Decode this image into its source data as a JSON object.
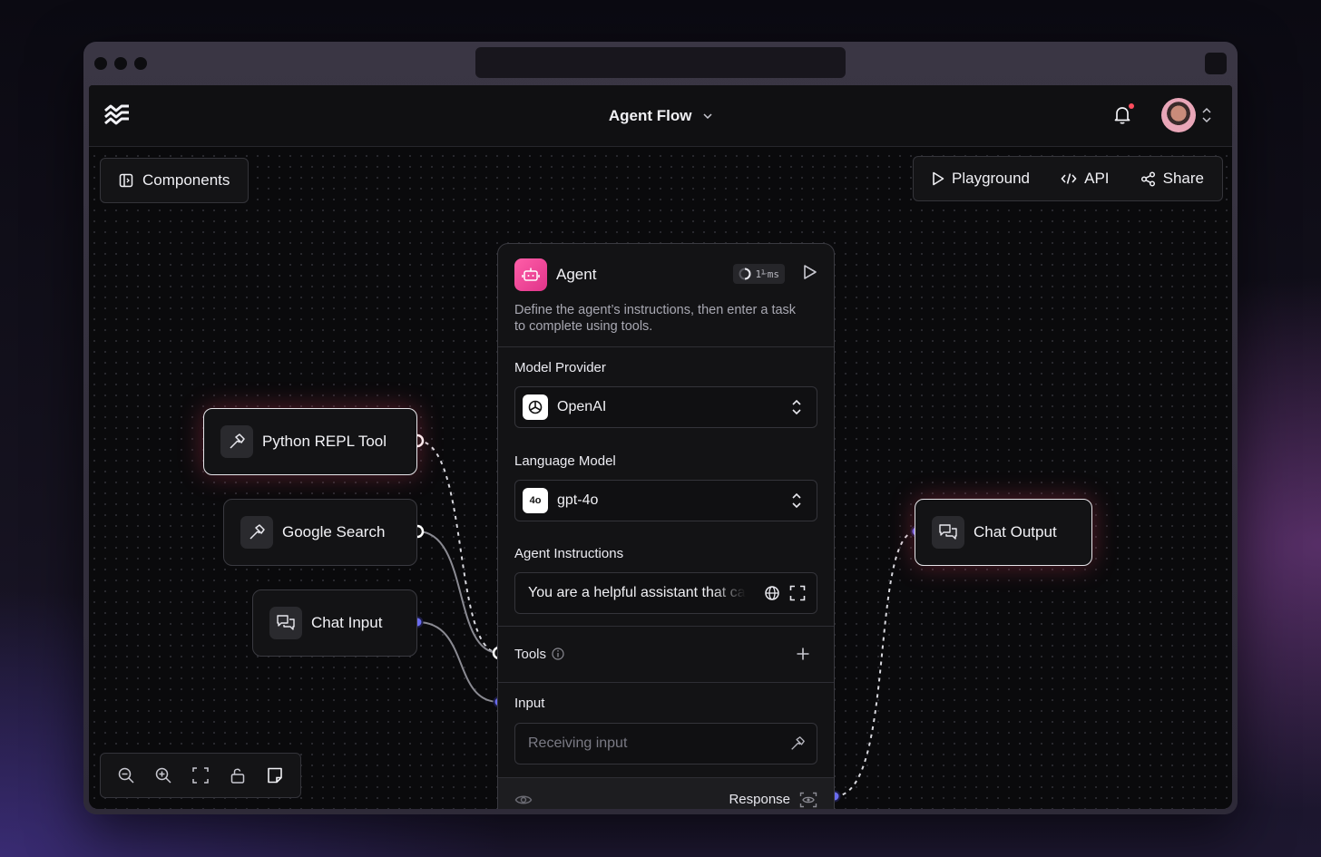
{
  "app": {
    "flow_title": "Agent Flow",
    "colors": {
      "accent_blue": "#6a6cf0",
      "agent_pink": "#ff5ea8",
      "notification": "#ff4d5e"
    }
  },
  "toolbar": {
    "components_label": "Components",
    "playground_label": "Playground",
    "api_label": "API",
    "share_label": "Share"
  },
  "nodes": {
    "python_repl": "Python REPL Tool",
    "google_search": "Google Search",
    "chat_input": "Chat Input",
    "chat_output": "Chat Output"
  },
  "agent": {
    "name": "Agent",
    "timer": "1⅟ms",
    "description": "Define the agent’s instructions, then enter a task to complete using tools.",
    "model_provider_label": "Model Provider",
    "model_provider_value": "OpenAI",
    "language_model_label": "Language Model",
    "language_model_badge": "4o",
    "language_model_value": "gpt-4o",
    "instructions_label": "Agent Instructions",
    "instructions_value": "You are a helpful assistant that can use tools",
    "tools_label": "Tools",
    "input_label": "Input",
    "input_placeholder": "Receiving input",
    "response_label": "Response"
  },
  "icons": [
    "logo-icon",
    "chevron-down-icon",
    "bell-icon",
    "sidebar-icon",
    "play-icon",
    "code-icon",
    "share-icon",
    "hammer-icon",
    "chat-icon",
    "robot-icon",
    "openai-icon",
    "globe-icon",
    "expand-icon",
    "info-icon",
    "plus-icon",
    "eye-icon",
    "zoom-out-icon",
    "zoom-in-icon",
    "fit-view-icon",
    "lock-icon",
    "note-icon"
  ]
}
